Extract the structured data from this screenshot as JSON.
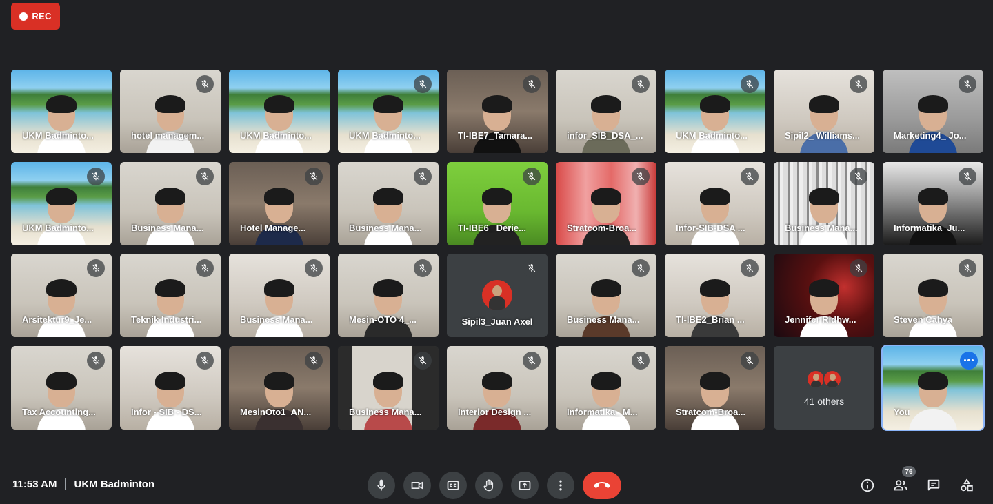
{
  "recording": {
    "label": "REC"
  },
  "participants": [
    {
      "name": "UKM Badminto...",
      "bg": "beach",
      "muted": false,
      "body": "#ffffff"
    },
    {
      "name": "hotel managem...",
      "bg": "room",
      "muted": true,
      "body": "#f2f2f2"
    },
    {
      "name": "UKM Badminto...",
      "bg": "beach",
      "muted": false,
      "body": "#ffffff"
    },
    {
      "name": "UKM Badminto...",
      "bg": "beach",
      "muted": true,
      "body": "#ffffff"
    },
    {
      "name": "TI-IBE7_Tamara...",
      "bg": "room2",
      "muted": true,
      "body": "#111111"
    },
    {
      "name": "infor_SIB_DSA_...",
      "bg": "room",
      "muted": true,
      "body": "#6b6b5a"
    },
    {
      "name": "UKM Badminto...",
      "bg": "beach",
      "muted": true,
      "body": "#ffffff"
    },
    {
      "name": "Sipil2_ Williams...",
      "bg": "room3",
      "muted": true,
      "body": "#4a6ea8"
    },
    {
      "name": "Marketing4_ Jo...",
      "bg": "grey",
      "muted": true,
      "body": "#1f4a96"
    },
    {
      "name": "UKM Badminto...",
      "bg": "beach",
      "muted": true,
      "body": "#ffffff"
    },
    {
      "name": "Business Mana...",
      "bg": "room",
      "muted": true,
      "body": "#ffffff"
    },
    {
      "name": "Hotel Manage...",
      "bg": "room2",
      "muted": true,
      "body": "#1d2a4a"
    },
    {
      "name": "Business Mana...",
      "bg": "room",
      "muted": true,
      "body": "#ffffff"
    },
    {
      "name": "TI-IBE6_ Derie...",
      "bg": "green",
      "muted": true,
      "body": "#222222"
    },
    {
      "name": "Stratcom-Broa...",
      "bg": "red",
      "muted": true,
      "body": "#222222"
    },
    {
      "name": "Infor-SIB-DSA ...",
      "bg": "room3",
      "muted": true,
      "body": "#ffffff"
    },
    {
      "name": "Business Mana...",
      "bg": "curtain",
      "muted": true,
      "body": "#ffffff"
    },
    {
      "name": "Informatika_Ju...",
      "bg": "dark",
      "muted": true,
      "body": "#111111"
    },
    {
      "name": "Arsitektur9_Je...",
      "bg": "room",
      "muted": true,
      "body": "#ffffff"
    },
    {
      "name": "Teknik Industri...",
      "bg": "room",
      "muted": true,
      "body": "#ffffff"
    },
    {
      "name": "Business Mana...",
      "bg": "room3",
      "muted": true,
      "body": "#ffffff"
    },
    {
      "name": "Mesin-OTO 4_...",
      "bg": "room",
      "muted": true,
      "body": "#2a2a2a"
    },
    {
      "name": "Sipil3_Juan Axel",
      "avatar": true,
      "muted": true
    },
    {
      "name": "Business Mana...",
      "bg": "room",
      "muted": true,
      "body": "#5a3a2a"
    },
    {
      "name": "TI-IBE2_Brian ...",
      "bg": "room3",
      "muted": true,
      "body": "#3a3a3a"
    },
    {
      "name": "Jennifer Ridhw...",
      "bg": "space",
      "muted": true,
      "body": "#ffffff"
    },
    {
      "name": "Steven Cahya",
      "bg": "room",
      "muted": true,
      "body": "#ffffff"
    },
    {
      "name": "Tax Accounting...",
      "bg": "room",
      "muted": true,
      "body": "#ffffff"
    },
    {
      "name": "Infor - SIB - DS...",
      "bg": "room3",
      "muted": true,
      "body": "#ffffff"
    },
    {
      "name": "MesinOto1_AN...",
      "bg": "room2",
      "muted": true,
      "body": "#3a3030"
    },
    {
      "name": "Business Mana...",
      "bg": "door",
      "muted": true,
      "body": "#b84a4a"
    },
    {
      "name": "Interior Design ...",
      "bg": "room",
      "muted": true,
      "body": "#7a2a2a"
    },
    {
      "name": "Informatika_ M...",
      "bg": "room",
      "muted": true,
      "body": "#ffffff"
    },
    {
      "name": "Stratcom-Broa...",
      "bg": "room2",
      "muted": true,
      "body": "#ffffff"
    },
    {
      "name": "41 others",
      "others": true
    },
    {
      "name": "You",
      "bg": "beach",
      "you": true,
      "body": "#f2f2f2"
    }
  ],
  "meeting": {
    "time": "11:53 AM",
    "title": "UKM Badminton"
  },
  "controls": [
    {
      "name": "microphone-button",
      "icon": "mic-icon"
    },
    {
      "name": "camera-button",
      "icon": "camera-icon"
    },
    {
      "name": "captions-button",
      "icon": "captions-icon"
    },
    {
      "name": "raise-hand-button",
      "icon": "hand-icon"
    },
    {
      "name": "present-screen-button",
      "icon": "present-icon"
    },
    {
      "name": "more-options-button",
      "icon": "more-vert-icon"
    }
  ],
  "people_count": "76",
  "colors": {
    "background": "#202124",
    "tile": "#3c4043",
    "accent": "#8ab4f8",
    "danger": "#ea4335",
    "rec": "#d93025"
  }
}
